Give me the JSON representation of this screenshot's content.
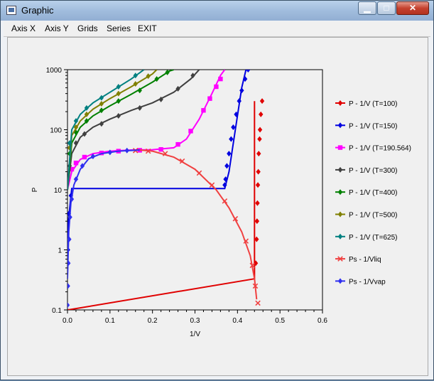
{
  "window": {
    "title": "Graphic",
    "close_glyph": "✕",
    "minimize_glyph": "▁",
    "maximize_glyph": "□"
  },
  "menu": [
    {
      "key": "axis_x",
      "label": "Axis X"
    },
    {
      "key": "axis_y",
      "label": "Axis Y"
    },
    {
      "key": "grids",
      "label": "Grids"
    },
    {
      "key": "series",
      "label": "Series"
    },
    {
      "key": "exit",
      "label": "EXIT"
    }
  ],
  "chart_data": {
    "type": "scatter",
    "xlabel": "1/V",
    "ylabel": "P",
    "xlim": [
      0,
      0.6
    ],
    "ylim": [
      0.1,
      1000
    ],
    "yscale": "log",
    "x_ticks": [
      "0.0",
      "0.1",
      "0.2",
      "0.3",
      "0.4",
      "0.5",
      "0.6"
    ],
    "y_ticks": [
      "0.1",
      "1",
      "10",
      "100",
      "1000"
    ],
    "grid": false,
    "legend_position": "right",
    "series": [
      {
        "name": "P - 1/V (T=100)",
        "color": "#e00000",
        "marker": "diamond",
        "line": [
          [
            0.001,
            0.1
          ],
          [
            0.44,
            0.33
          ],
          [
            0.44,
            300
          ]
        ],
        "points": [
          [
            0.443,
            0.6
          ],
          [
            0.445,
            1.5
          ],
          [
            0.446,
            3
          ],
          [
            0.447,
            6
          ],
          [
            0.448,
            12
          ],
          [
            0.449,
            20
          ],
          [
            0.45,
            40
          ],
          [
            0.452,
            70
          ],
          [
            0.453,
            100
          ],
          [
            0.455,
            180
          ],
          [
            0.458,
            300
          ]
        ]
      },
      {
        "name": "P - 1/V (T=150)",
        "color": "#0000e0",
        "marker": "diamond",
        "line": [
          [
            0.0,
            0.4
          ],
          [
            0.002,
            3
          ],
          [
            0.01,
            10.5
          ],
          [
            0.37,
            10.5
          ],
          [
            0.38,
            20
          ],
          [
            0.395,
            100
          ],
          [
            0.41,
            500
          ],
          [
            0.42,
            1000
          ]
        ],
        "points": [
          [
            0.001,
            1
          ],
          [
            0.003,
            4
          ],
          [
            0.008,
            8
          ],
          [
            0.37,
            12
          ],
          [
            0.372,
            15
          ],
          [
            0.375,
            25
          ],
          [
            0.38,
            40
          ],
          [
            0.385,
            70
          ],
          [
            0.39,
            110
          ],
          [
            0.397,
            180
          ],
          [
            0.404,
            300
          ],
          [
            0.41,
            450
          ],
          [
            0.418,
            700
          ],
          [
            0.425,
            1000
          ]
        ]
      },
      {
        "name": "P - 1/V (T=190.564)",
        "color": "#ff00ff",
        "marker": "square",
        "line": [
          [
            0.0,
            10
          ],
          [
            0.01,
            20
          ],
          [
            0.03,
            32
          ],
          [
            0.06,
            40
          ],
          [
            0.1,
            44
          ],
          [
            0.15,
            46
          ],
          [
            0.2,
            46.5
          ],
          [
            0.25,
            50
          ],
          [
            0.28,
            70
          ],
          [
            0.31,
            150
          ],
          [
            0.34,
            400
          ],
          [
            0.36,
            800
          ],
          [
            0.37,
            1000
          ]
        ],
        "points": [
          [
            0.01,
            22
          ],
          [
            0.02,
            28
          ],
          [
            0.04,
            35
          ],
          [
            0.08,
            41
          ],
          [
            0.12,
            44
          ],
          [
            0.17,
            45.5
          ],
          [
            0.22,
            47
          ],
          [
            0.26,
            57
          ],
          [
            0.29,
            95
          ],
          [
            0.32,
            210
          ],
          [
            0.335,
            330
          ],
          [
            0.35,
            520
          ],
          [
            0.36,
            700
          ]
        ]
      },
      {
        "name": "P - 1/V (T=300)",
        "color": "#404040",
        "marker": "diamond",
        "line": [
          [
            0.0,
            10
          ],
          [
            0.01,
            40
          ],
          [
            0.03,
            75
          ],
          [
            0.06,
            110
          ],
          [
            0.1,
            150
          ],
          [
            0.15,
            210
          ],
          [
            0.2,
            280
          ],
          [
            0.25,
            420
          ],
          [
            0.29,
            700
          ],
          [
            0.31,
            1000
          ]
        ],
        "points": [
          [
            0.005,
            25
          ],
          [
            0.02,
            60
          ],
          [
            0.04,
            85
          ],
          [
            0.08,
            125
          ],
          [
            0.12,
            170
          ],
          [
            0.17,
            230
          ],
          [
            0.22,
            320
          ],
          [
            0.26,
            480
          ],
          [
            0.295,
            800
          ]
        ]
      },
      {
        "name": "P - 1/V (T=400)",
        "color": "#008000",
        "marker": "diamond",
        "line": [
          [
            0.0,
            10
          ],
          [
            0.01,
            60
          ],
          [
            0.03,
            110
          ],
          [
            0.06,
            170
          ],
          [
            0.1,
            250
          ],
          [
            0.15,
            390
          ],
          [
            0.2,
            620
          ],
          [
            0.24,
            950
          ],
          [
            0.25,
            1000
          ]
        ],
        "points": [
          [
            0.005,
            40
          ],
          [
            0.02,
            90
          ],
          [
            0.045,
            140
          ],
          [
            0.08,
            210
          ],
          [
            0.12,
            300
          ],
          [
            0.17,
            450
          ],
          [
            0.21,
            700
          ],
          [
            0.235,
            900
          ]
        ]
      },
      {
        "name": "P - 1/V (T=500)",
        "color": "#808000",
        "marker": "diamond",
        "line": [
          [
            0.0,
            10
          ],
          [
            0.01,
            80
          ],
          [
            0.03,
            140
          ],
          [
            0.06,
            220
          ],
          [
            0.1,
            330
          ],
          [
            0.15,
            520
          ],
          [
            0.2,
            850
          ],
          [
            0.21,
            1000
          ]
        ],
        "points": [
          [
            0.005,
            50
          ],
          [
            0.02,
            110
          ],
          [
            0.045,
            180
          ],
          [
            0.08,
            270
          ],
          [
            0.12,
            400
          ],
          [
            0.16,
            580
          ],
          [
            0.19,
            780
          ]
        ]
      },
      {
        "name": "P - 1/V (T=625)",
        "color": "#008080",
        "marker": "diamond",
        "line": [
          [
            0.0,
            10
          ],
          [
            0.01,
            100
          ],
          [
            0.03,
            180
          ],
          [
            0.06,
            280
          ],
          [
            0.1,
            420
          ],
          [
            0.15,
            700
          ],
          [
            0.18,
            1000
          ]
        ],
        "points": [
          [
            0.005,
            60
          ],
          [
            0.02,
            140
          ],
          [
            0.045,
            230
          ],
          [
            0.08,
            340
          ],
          [
            0.12,
            520
          ],
          [
            0.16,
            800
          ]
        ]
      },
      {
        "name": "Ps - 1/Vliq",
        "color": "#f04040",
        "marker": "x",
        "line": [
          [
            0.17,
            46
          ],
          [
            0.2,
            44
          ],
          [
            0.25,
            35
          ],
          [
            0.3,
            22
          ],
          [
            0.35,
            10
          ],
          [
            0.38,
            5
          ],
          [
            0.41,
            2
          ],
          [
            0.43,
            0.8
          ],
          [
            0.44,
            0.33
          ],
          [
            0.445,
            0.15
          ]
        ],
        "points": [
          [
            0.16,
            45
          ],
          [
            0.19,
            44
          ],
          [
            0.23,
            40
          ],
          [
            0.27,
            30
          ],
          [
            0.31,
            19
          ],
          [
            0.34,
            12
          ],
          [
            0.37,
            6.5
          ],
          [
            0.395,
            3.3
          ],
          [
            0.42,
            1.4
          ],
          [
            0.435,
            0.55
          ],
          [
            0.442,
            0.25
          ],
          [
            0.448,
            0.13
          ]
        ]
      },
      {
        "name": "Ps - 1/Vvap",
        "color": "#3030f0",
        "marker": "diamond",
        "line": [
          [
            0.0,
            0.33
          ],
          [
            0.003,
            2
          ],
          [
            0.008,
            6
          ],
          [
            0.015,
            12
          ],
          [
            0.03,
            22
          ],
          [
            0.05,
            33
          ],
          [
            0.08,
            40
          ],
          [
            0.12,
            44
          ],
          [
            0.17,
            46
          ]
        ],
        "points": [
          [
            0.0,
            0.12
          ],
          [
            0.001,
            0.25
          ],
          [
            0.002,
            0.6
          ],
          [
            0.004,
            1.5
          ],
          [
            0.006,
            3.5
          ],
          [
            0.01,
            7
          ],
          [
            0.02,
            15
          ],
          [
            0.035,
            25
          ],
          [
            0.06,
            36
          ],
          [
            0.1,
            42
          ],
          [
            0.14,
            45
          ]
        ]
      }
    ]
  }
}
